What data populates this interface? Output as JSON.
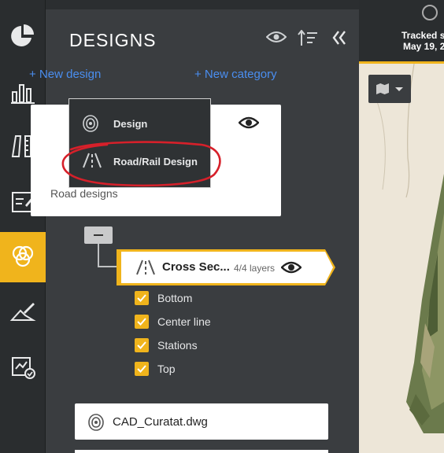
{
  "rail": {
    "items": [
      {
        "icon": "pie-chart-icon"
      },
      {
        "icon": "bar-chart-icon"
      },
      {
        "icon": "measure-tools-icon"
      },
      {
        "icon": "edit-document-icon"
      },
      {
        "icon": "layers-designs-icon",
        "active": true
      },
      {
        "icon": "survey-draw-icon"
      },
      {
        "icon": "report-check-icon"
      }
    ],
    "accent": "#f0b41c"
  },
  "topbar": {
    "tracked_text": "Tracked si",
    "date_text": "May 19, 2"
  },
  "panel": {
    "title": "DESIGNS",
    "new_design_label": "+ New design",
    "new_category_label": "+ New category",
    "category_label": "Road designs",
    "design": {
      "name": "Cross Sec...",
      "layers": "4/4 layers"
    },
    "layers": [
      {
        "label": "Bottom",
        "checked": true
      },
      {
        "label": "Center line",
        "checked": true
      },
      {
        "label": "Stations",
        "checked": true
      },
      {
        "label": "Top",
        "checked": true
      }
    ],
    "file_name": "CAD_Curatat.dwg"
  },
  "dropdown": {
    "items": [
      {
        "label": "Design",
        "icon": "design-icon"
      },
      {
        "label": "Road/Rail Design",
        "icon": "road-icon"
      }
    ]
  },
  "colors": {
    "accent": "#f0b41c",
    "link": "#4a8ef0",
    "panel": "#3a3d40",
    "annotation": "#d6202a"
  }
}
